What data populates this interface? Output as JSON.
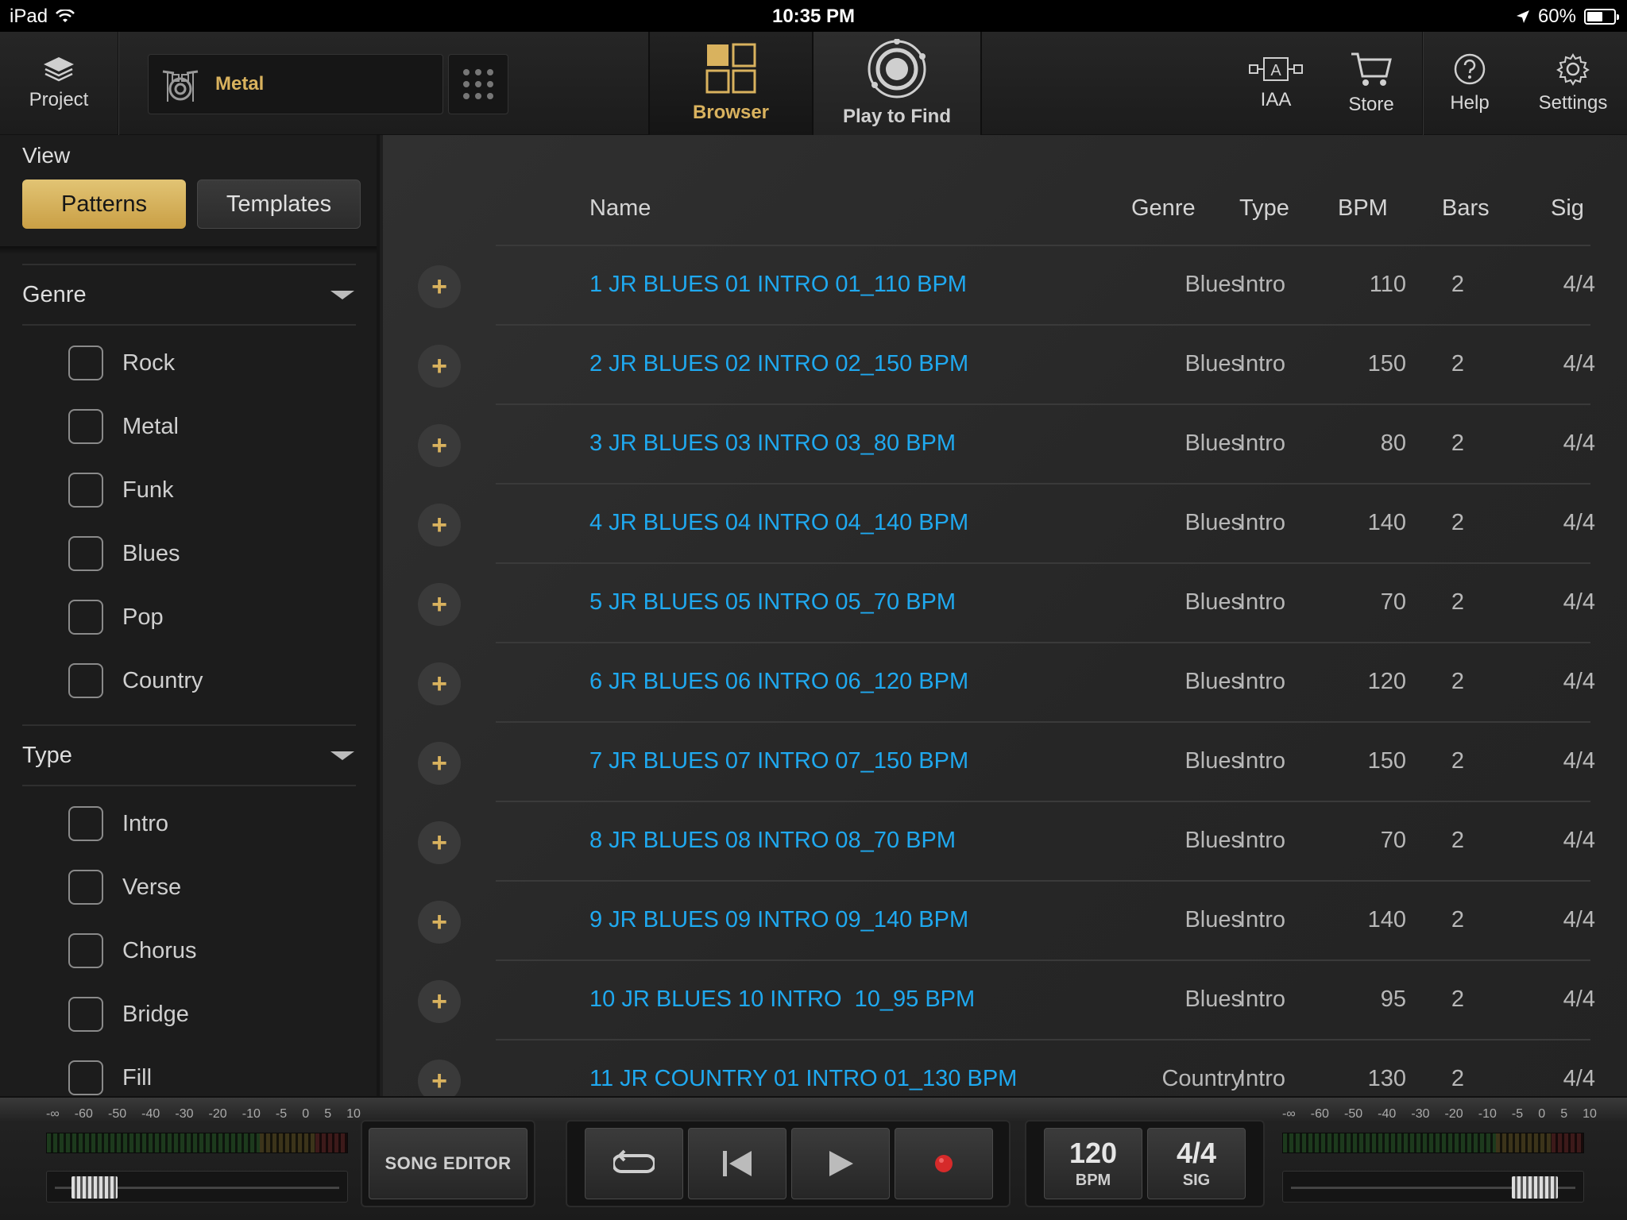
{
  "status": {
    "device": "iPad",
    "time": "10:35 PM",
    "battery": "60%",
    "battery_level": 0.6
  },
  "toolbar": {
    "project_label": "Project",
    "preset_name": "Metal",
    "browser_label": "Browser",
    "play_to_find_label": "Play to Find",
    "iaa_label": "IAA",
    "iaa_icon_text": "A",
    "store_label": "Store",
    "help_label": "Help",
    "settings_label": "Settings"
  },
  "sidebar": {
    "view_title": "View",
    "view_options": [
      "Patterns",
      "Templates"
    ],
    "genre": {
      "title": "Genre",
      "items": [
        "Rock",
        "Metal",
        "Funk",
        "Blues",
        "Pop",
        "Country"
      ]
    },
    "type": {
      "title": "Type",
      "items": [
        "Intro",
        "Verse",
        "Chorus",
        "Bridge",
        "Fill"
      ]
    }
  },
  "table": {
    "columns": [
      "Name",
      "Genre",
      "Type",
      "BPM",
      "Bars",
      "Sig"
    ],
    "add_symbol": "+",
    "rows": [
      {
        "name": "1 JR BLUES 01 INTRO 01_110 BPM",
        "genre": "Blues",
        "type": "Intro",
        "bpm": "110",
        "bars": "2",
        "sig": "4/4"
      },
      {
        "name": "2 JR BLUES 02 INTRO 02_150 BPM",
        "genre": "Blues",
        "type": "Intro",
        "bpm": "150",
        "bars": "2",
        "sig": "4/4"
      },
      {
        "name": "3 JR BLUES 03 INTRO 03_80 BPM",
        "genre": "Blues",
        "type": "Intro",
        "bpm": "80",
        "bars": "2",
        "sig": "4/4"
      },
      {
        "name": "4 JR BLUES 04 INTRO 04_140 BPM",
        "genre": "Blues",
        "type": "Intro",
        "bpm": "140",
        "bars": "2",
        "sig": "4/4"
      },
      {
        "name": "5 JR BLUES 05 INTRO 05_70 BPM",
        "genre": "Blues",
        "type": "Intro",
        "bpm": "70",
        "bars": "2",
        "sig": "4/4"
      },
      {
        "name": "6 JR BLUES 06 INTRO 06_120 BPM",
        "genre": "Blues",
        "type": "Intro",
        "bpm": "120",
        "bars": "2",
        "sig": "4/4"
      },
      {
        "name": "7 JR BLUES 07 INTRO 07_150 BPM",
        "genre": "Blues",
        "type": "Intro",
        "bpm": "150",
        "bars": "2",
        "sig": "4/4"
      },
      {
        "name": "8 JR BLUES 08 INTRO 08_70 BPM",
        "genre": "Blues",
        "type": "Intro",
        "bpm": "70",
        "bars": "2",
        "sig": "4/4"
      },
      {
        "name": "9 JR BLUES 09 INTRO 09_140 BPM",
        "genre": "Blues",
        "type": "Intro",
        "bpm": "140",
        "bars": "2",
        "sig": "4/4"
      },
      {
        "name": "10 JR BLUES 10 INTRO  10_95 BPM",
        "genre": "Blues",
        "type": "Intro",
        "bpm": "95",
        "bars": "2",
        "sig": "4/4"
      },
      {
        "name": "11 JR COUNTRY 01 INTRO 01_130 BPM",
        "genre": "Country",
        "type": "Intro",
        "bpm": "130",
        "bars": "2",
        "sig": "4/4"
      }
    ]
  },
  "transport": {
    "meter_scale": [
      "-∞",
      "-60",
      "-50",
      "-40",
      "-30",
      "-20",
      "-10",
      "-5",
      "0",
      "5",
      "10"
    ],
    "song_editor_label": "SONG EDITOR",
    "tempo_value": "120",
    "tempo_unit": "BPM",
    "sig_value": "4/4",
    "sig_unit": "SIG",
    "left_slider_level": 0.07,
    "right_slider_level": 0.92,
    "record_color": "#d62a2a"
  },
  "colors": {
    "accent_gold": "#d9b25e",
    "link_blue": "#1fa9f0"
  }
}
